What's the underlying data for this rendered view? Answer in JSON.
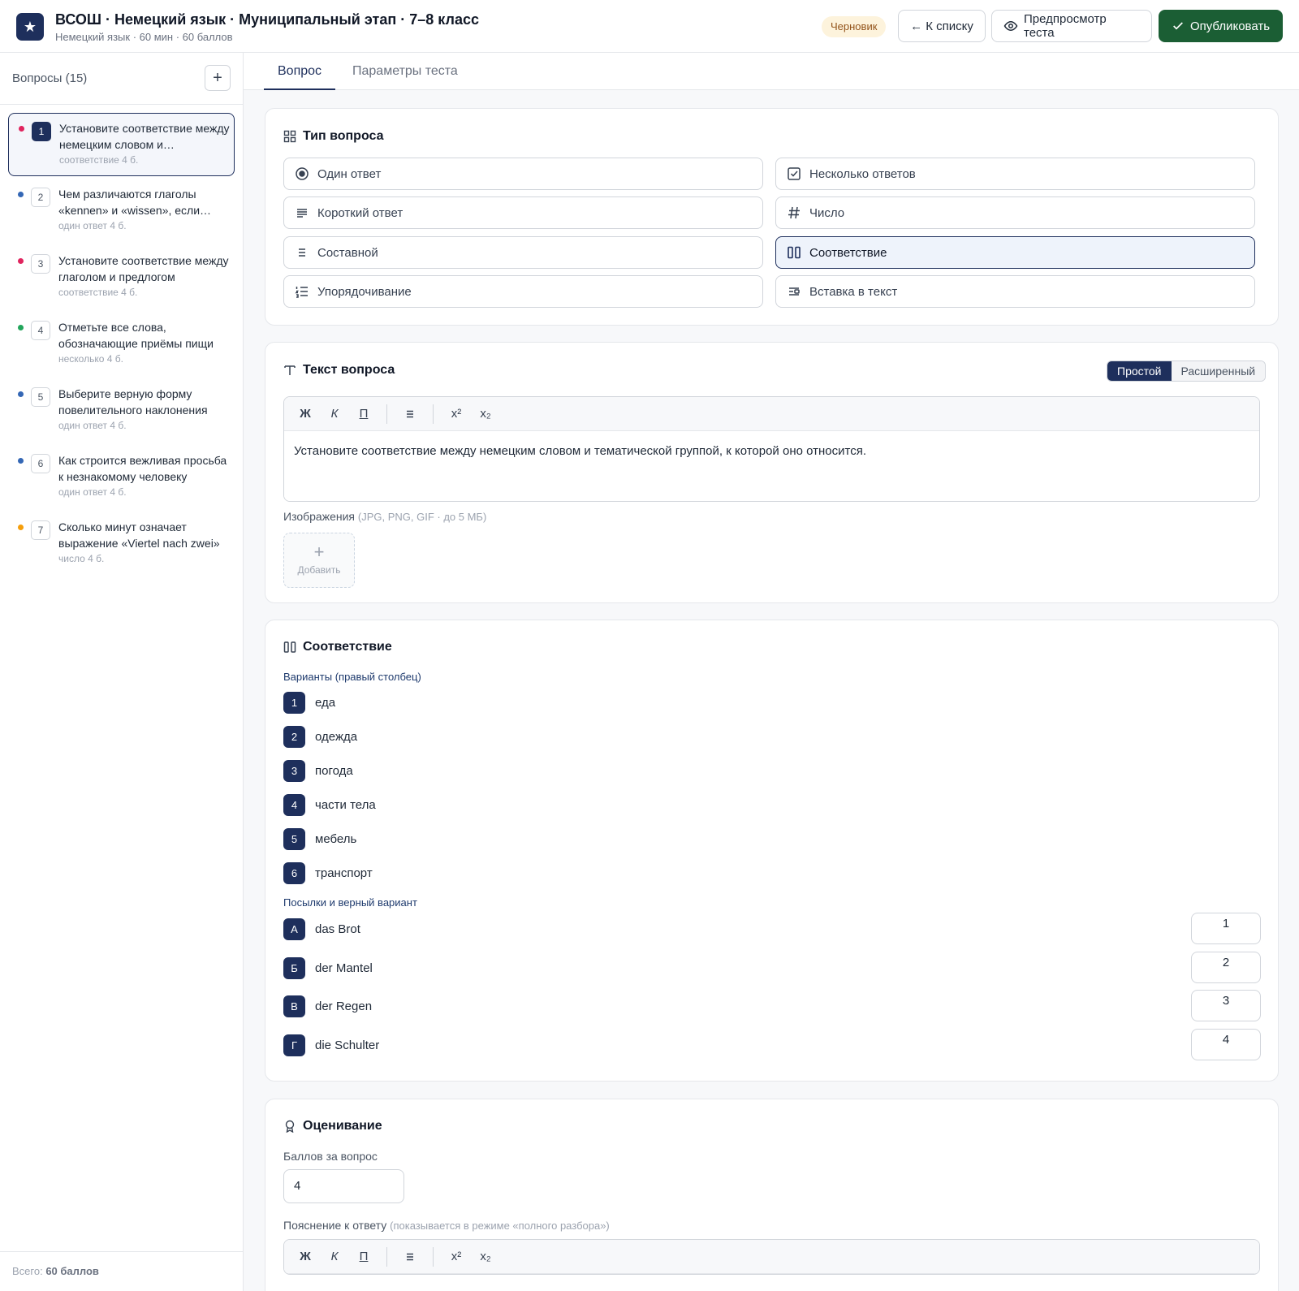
{
  "header": {
    "title": "ВСОШ · Немецкий язык · Муниципальный этап · 7–8 класс",
    "subtitle": "Немецкий язык · 60 мин · 60 баллов",
    "status_badge": "Черновик",
    "back_label": "← К списку",
    "preview_label": "Предпросмотр теста",
    "publish_label": "Опубликовать"
  },
  "sidebar": {
    "title": "Вопросы (15)",
    "add_label": "+",
    "questions": [
      {
        "num": "1",
        "text": "Установите соответствие между немецким словом и тематической группой",
        "meta": "соответствие  4 б.",
        "dot": "#e0245e"
      },
      {
        "num": "2",
        "text": "Чем различаются глаголы «kennen» и «wissen», если говорить о знании",
        "meta": "один ответ  4 б.",
        "dot": "#3467b5"
      },
      {
        "num": "3",
        "text": "Установите соответствие между глаголом и предлогом",
        "meta": "соответствие  4 б.",
        "dot": "#e0245e"
      },
      {
        "num": "4",
        "text": "Отметьте все слова, обозначающие приёмы пищи",
        "meta": "несколько  4 б.",
        "dot": "#22a55b"
      },
      {
        "num": "5",
        "text": "Выберите верную форму повелительного наклонения",
        "meta": "один ответ  4 б.",
        "dot": "#3467b5"
      },
      {
        "num": "6",
        "text": "Как строится вежливая просьба к незнакомому человеку",
        "meta": "один ответ  4 б.",
        "dot": "#3467b5"
      },
      {
        "num": "7",
        "text": "Сколько минут означает выражение «Viertel nach zwei»",
        "meta": "число  4 б.",
        "dot": "#f59e0b"
      }
    ],
    "total_prefix": "Всего: ",
    "total_value": "60 баллов"
  },
  "tabs": [
    {
      "label": "Вопрос"
    },
    {
      "label": "Параметры теста"
    }
  ],
  "type_card": {
    "title": "Тип вопроса",
    "types": [
      {
        "label": "Один ответ",
        "icon": "radio-icon"
      },
      {
        "label": "Несколько ответов",
        "icon": "checkbox-icon"
      },
      {
        "label": "Короткий ответ",
        "icon": "short-text-icon"
      },
      {
        "label": "Число",
        "icon": "hash-icon"
      },
      {
        "label": "Составной",
        "icon": "list-icon"
      },
      {
        "label": "Соответствие",
        "icon": "columns-icon"
      },
      {
        "label": "Упорядочивание",
        "icon": "ordered-list-icon"
      },
      {
        "label": "Вставка в текст",
        "icon": "insert-text-icon"
      }
    ],
    "selected": "Соответствие"
  },
  "text_card": {
    "title": "Текст вопроса",
    "mode_simple": "Простой",
    "mode_advanced": "Расширенный",
    "toolbar": {
      "bold": "Ж",
      "italic": "К",
      "underline": "П",
      "sup": "x²",
      "sub": "x₂"
    },
    "body": "Установите соответствие между немецким словом и тематической группой, к которой оно относится.",
    "images_label": "Изображения",
    "images_hint": "(JPG, PNG, GIF · до 5 МБ)",
    "add_image_label": "Добавить"
  },
  "match_card": {
    "title": "Соответствие",
    "options_label": "Варианты (правый столбец)",
    "options": [
      {
        "key": "1",
        "text": "еда"
      },
      {
        "key": "2",
        "text": "одежда"
      },
      {
        "key": "3",
        "text": "погода"
      },
      {
        "key": "4",
        "text": "части тела"
      },
      {
        "key": "5",
        "text": "мебель"
      },
      {
        "key": "6",
        "text": "транспорт"
      }
    ],
    "premises_label": "Посылки и верный вариант",
    "premises": [
      {
        "key": "А",
        "text": "das Brot",
        "answer": "1"
      },
      {
        "key": "Б",
        "text": "der Mantel",
        "answer": "2"
      },
      {
        "key": "В",
        "text": "der Regen",
        "answer": "3"
      },
      {
        "key": "Г",
        "text": "die Schulter",
        "answer": "4"
      }
    ]
  },
  "grading_card": {
    "title": "Оценивание",
    "points_label": "Баллов за вопрос",
    "points_value": "4",
    "explanation_label": "Пояснение к ответу",
    "explanation_hint": "(показывается в режиме «полного разбора»)"
  },
  "colors": {
    "accent": "#1e2f5c",
    "publish": "#1b5e34",
    "draft_bg": "#fdf3dc",
    "draft_text": "#92531a"
  }
}
